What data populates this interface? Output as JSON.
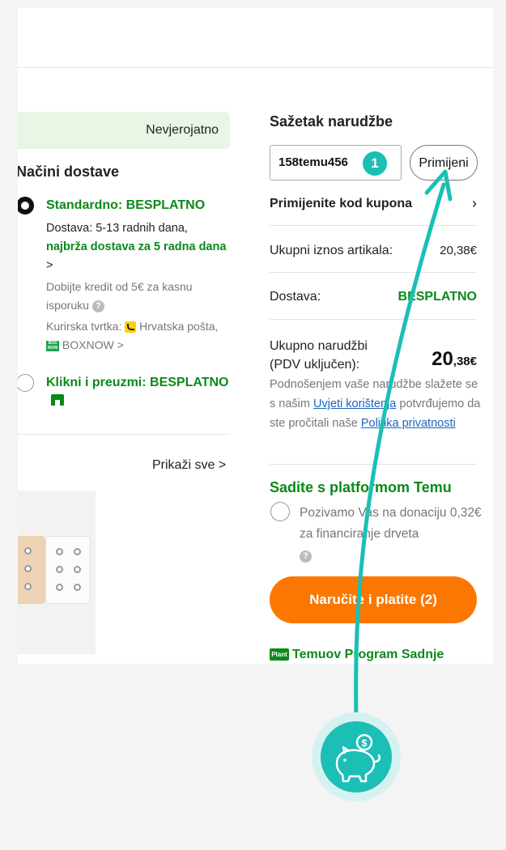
{
  "left": {
    "banner_text": "Nevjerojatno",
    "shipping_title": "Načini dostave",
    "option1": {
      "title": "Standardno: BESPLATNO",
      "line1": "Dostava: 5-13 radnih dana,",
      "fast_text": "najbrža dostava za 5 radna dana",
      "chevron": ">",
      "credit_text": "Dobijte kredit od 5€ za kasnu isporuku",
      "courier_label": "Kurirska tvrtka:",
      "courier1": "Hrvatska pošta,",
      "courier2": "BOXNOW",
      "boxnow_icon_text": "BOX NOW"
    },
    "option2": {
      "title": "Klikni i preuzmi: BESPLATNO"
    },
    "show_all": "Prikaži sve"
  },
  "summary": {
    "title": "Sažetak narudžbe",
    "coupon_value": "158temu456",
    "step_badge": "1",
    "apply_label": "Primijeni",
    "coupon_link": "Primijenite kod kupona",
    "items_total_label": "Ukupni iznos artikala:",
    "items_total_value": "20,38€",
    "shipping_label": "Dostava:",
    "shipping_value": "BESPLATNO",
    "order_total_label1": "Ukupno narudžbi",
    "order_total_label2": "(PDV uključen):",
    "order_total_int": "20",
    "order_total_dec": ",38€",
    "legal_text1": "Podnošenjem vaše narudžbe slažete se s našim",
    "terms_link": "Uvjeti korištenja",
    "legal_text2": "potvrđujemo da ste pročitali naše",
    "privacy_link": "Politika privatnosti",
    "plant_title": "Sadite s platformom Temu",
    "plant_text": "Pozivamo Vas na donaciju 0,32€ za financiranje drveta",
    "order_button": "Naručite i platite (2)",
    "plant_program_badge": "Plant",
    "plant_program": "Temuov Program Sadnje"
  },
  "colors": {
    "accent_green": "#0a8a1a",
    "order_orange": "#fb7701",
    "annotation_teal": "#1bbfb6",
    "link_blue": "#1a66c0"
  },
  "icons": {
    "coupon_chevron": "chevron-right-icon",
    "help": "question-icon",
    "piggy": "piggy-bank-icon"
  }
}
